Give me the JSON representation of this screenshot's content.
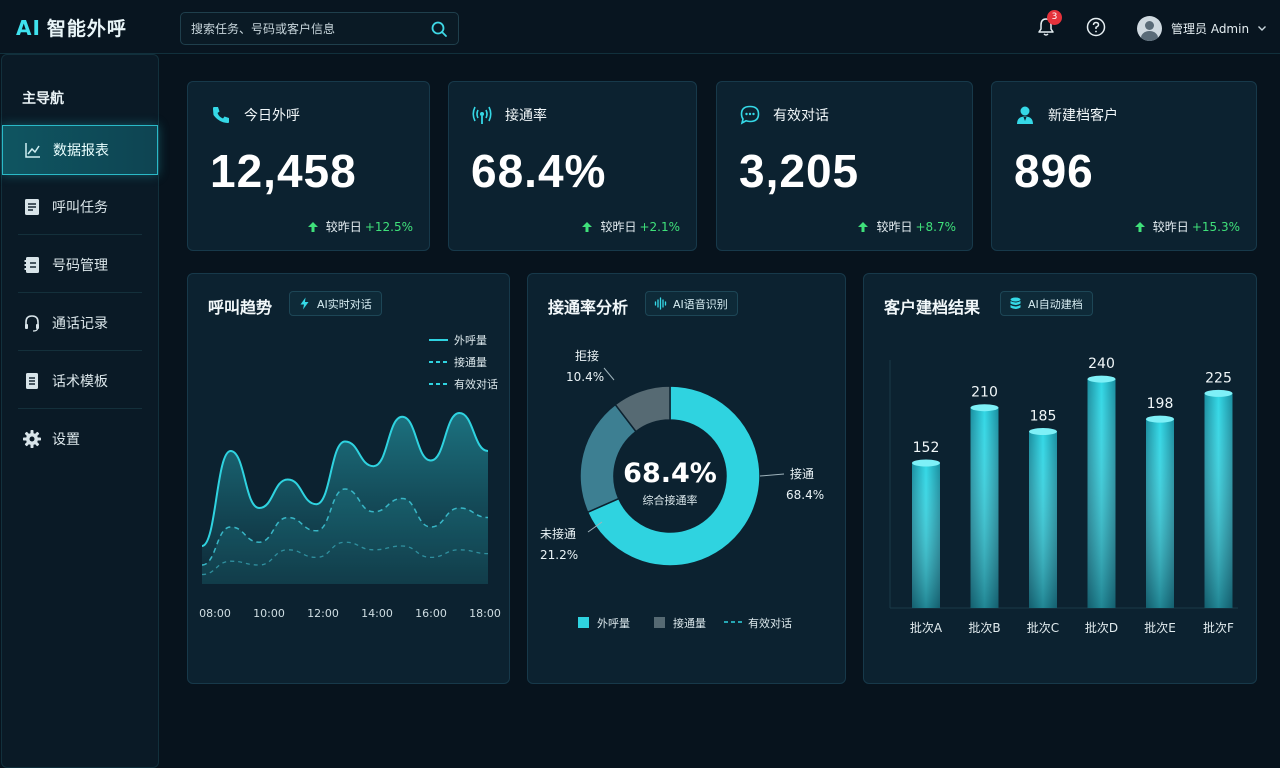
{
  "app": {
    "logo_ai": "AI",
    "logo_text": "智能外呼"
  },
  "search": {
    "placeholder": "搜索任务、号码或客户信息"
  },
  "header": {
    "notification_count": "3",
    "user_name": "管理员 Admin"
  },
  "sidebar": {
    "title": "主导航",
    "items": [
      {
        "label": "数据报表",
        "icon": "line-chart-icon",
        "active": true
      },
      {
        "label": "呼叫任务",
        "icon": "task-list-icon",
        "active": false
      },
      {
        "label": "号码管理",
        "icon": "contacts-icon",
        "active": false
      },
      {
        "label": "通话记录",
        "icon": "headset-icon",
        "active": false
      },
      {
        "label": "话术模板",
        "icon": "document-icon",
        "active": false
      },
      {
        "label": "设置",
        "icon": "gear-icon",
        "active": false
      }
    ]
  },
  "kpis": [
    {
      "label": "今日外呼",
      "icon": "phone-icon",
      "value": "12,458",
      "compare": "较昨日",
      "change": "+12.5%"
    },
    {
      "label": "接通率",
      "icon": "signal-icon",
      "value": "68.4%",
      "compare": "较昨日",
      "change": "+2.1%"
    },
    {
      "label": "有效对话",
      "icon": "chat-icon",
      "value": "3,205",
      "compare": "较昨日",
      "change": "+8.7%"
    },
    {
      "label": "新建档客户",
      "icon": "user-icon",
      "value": "896",
      "compare": "较昨日",
      "change": "+15.3%"
    }
  ],
  "panels": {
    "trend": {
      "title": "呼叫趋势",
      "tag": "AI实时对话"
    },
    "rate": {
      "title": "接通率分析",
      "tag": "AI语音识别"
    },
    "archive": {
      "title": "客户建档结果",
      "tag": "AI自动建档"
    }
  },
  "colors": {
    "accent": "#2fd3e0",
    "gray": "#566a73",
    "steel": "#3d7f92",
    "up": "#3fe07a",
    "badge": "#e5323b"
  },
  "chart_data": [
    {
      "type": "area",
      "x": [
        "08:00",
        "10:00",
        "12:00",
        "14:00",
        "16:00",
        "18:00"
      ],
      "series": [
        {
          "name": "外呼量",
          "values": [
            20,
            70,
            40,
            55,
            42,
            75,
            62,
            88,
            65,
            90,
            70
          ]
        },
        {
          "name": "接通量",
          "values": [
            10,
            30,
            22,
            35,
            28,
            50,
            38,
            45,
            30,
            40,
            35
          ]
        },
        {
          "name": "有效对话",
          "values": [
            5,
            12,
            10,
            18,
            14,
            22,
            18,
            20,
            14,
            18,
            16
          ]
        }
      ],
      "legend": "top-right"
    },
    {
      "type": "pie",
      "center_value": "68.4%",
      "center_label": "综合接通率",
      "slices": [
        {
          "label": "接通",
          "value": 68.4,
          "display": "68.4%"
        },
        {
          "label": "未接通",
          "value": 21.2,
          "display": "21.2%"
        },
        {
          "label": "拒接",
          "value": 10.4,
          "display": "10.4%"
        }
      ],
      "legend": [
        "外呼量",
        "接通量",
        "有效对话"
      ]
    },
    {
      "type": "bar",
      "categories": [
        "批次A",
        "批次B",
        "批次C",
        "批次D",
        "批次E",
        "批次F"
      ],
      "values": [
        152,
        210,
        185,
        240,
        198,
        225
      ],
      "ylim": [
        0,
        260
      ]
    }
  ]
}
